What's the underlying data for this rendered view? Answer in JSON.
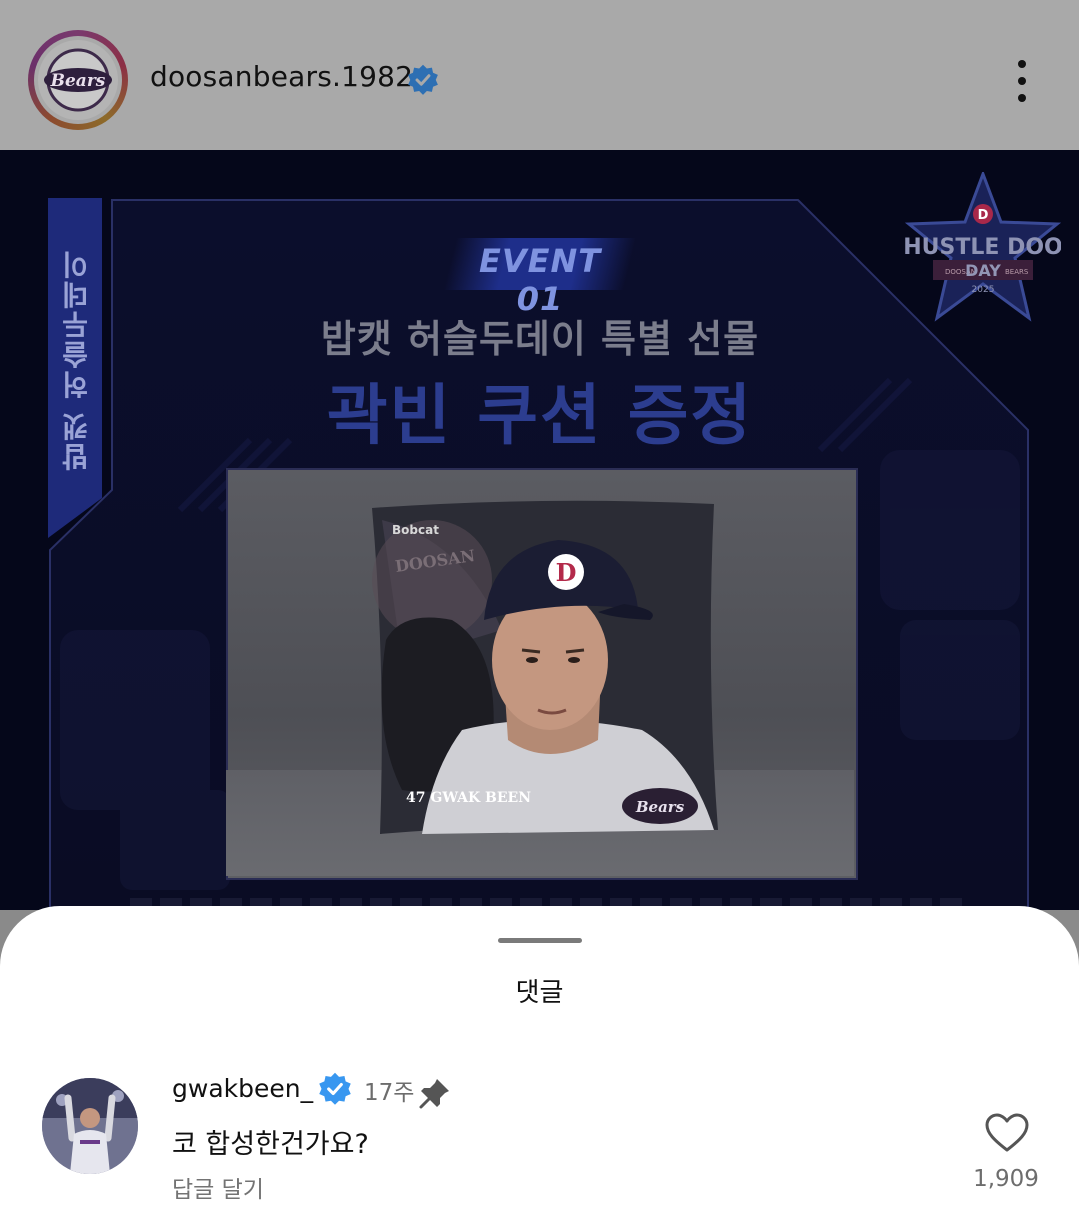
{
  "header": {
    "username": "doosanbears.1982",
    "avatar_logo_text": "Bears"
  },
  "post": {
    "side_label": "밥캣 허슬두데이",
    "event_label": "EVENT 01",
    "subtitle": "밥캣 허슬두데이 특별 선물",
    "headline": "곽빈 쿠션 증정",
    "badge_title": "HUSTLE DOO",
    "badge_sub": "DAY",
    "badge_left": "DOOSAN",
    "badge_right": "BEARS",
    "badge_year": "2025",
    "pillow_brand": "Bobcat",
    "pillow_team": "DOOSAN",
    "pillow_name": "47 GWAK BEEN",
    "pillow_logo": "Bears",
    "cap_letter": "D"
  },
  "comments": {
    "title": "댓글",
    "items": [
      {
        "user": "gwakbeen_",
        "time": "17주",
        "text": "코 합성한건가요?",
        "reply_label": "답글 달기",
        "likes": "1,909"
      }
    ]
  },
  "colors": {
    "verified": "#3897f0",
    "sheet_bg": "#ffffff",
    "post_bg": "#05071a"
  }
}
